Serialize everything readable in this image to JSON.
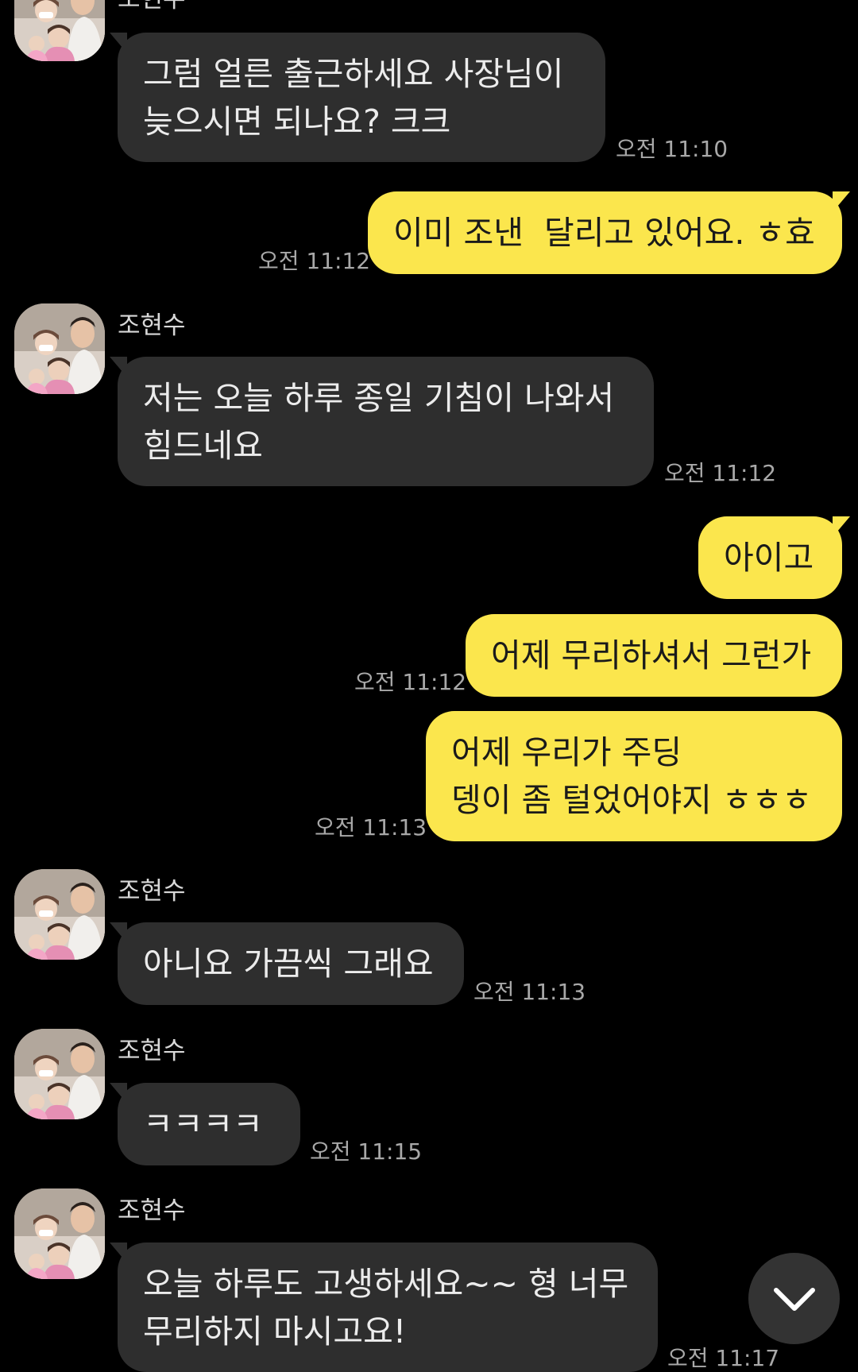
{
  "chat": {
    "messages": [
      {
        "sender": "조현수",
        "text": "그럼 얼른 출근하세요 사장님이\n늦으시면 되나요? 크크",
        "time": "오전 11:10"
      },
      {
        "text": "이미 조낸  달리고 있어요. ㅎ효",
        "time": "오전 11:12"
      },
      {
        "sender": "조현수",
        "text": "저는 오늘 하루 종일 기침이 나와서\n힘드네요",
        "time": "오전 11:12"
      },
      {
        "text": "아이고"
      },
      {
        "text": "어제 무리하셔서 그런가",
        "time": "오전 11:12"
      },
      {
        "text": "어제 우리가 주딩\n뎅이 좀 털었어야지 ㅎㅎㅎ",
        "time": "오전 11:13"
      },
      {
        "sender": "조현수",
        "text": "아니요 가끔씩 그래요",
        "time": "오전 11:13"
      },
      {
        "sender": "조현수",
        "text": "ㅋㅋㅋㅋ",
        "time": "오전 11:15"
      },
      {
        "sender": "조현수",
        "text": "오늘 하루도 고생하세요~~ 형 너무\n무리하지 마시고요!",
        "time": "오전 11:17"
      }
    ]
  },
  "icons": {
    "avatar": "profile-photo",
    "scroll": "chevron-down-icon"
  },
  "colors": {
    "background": "#000000",
    "incoming": "#2e2e2e",
    "outgoing": "#fbe64d",
    "time": "#a8a8a8"
  }
}
